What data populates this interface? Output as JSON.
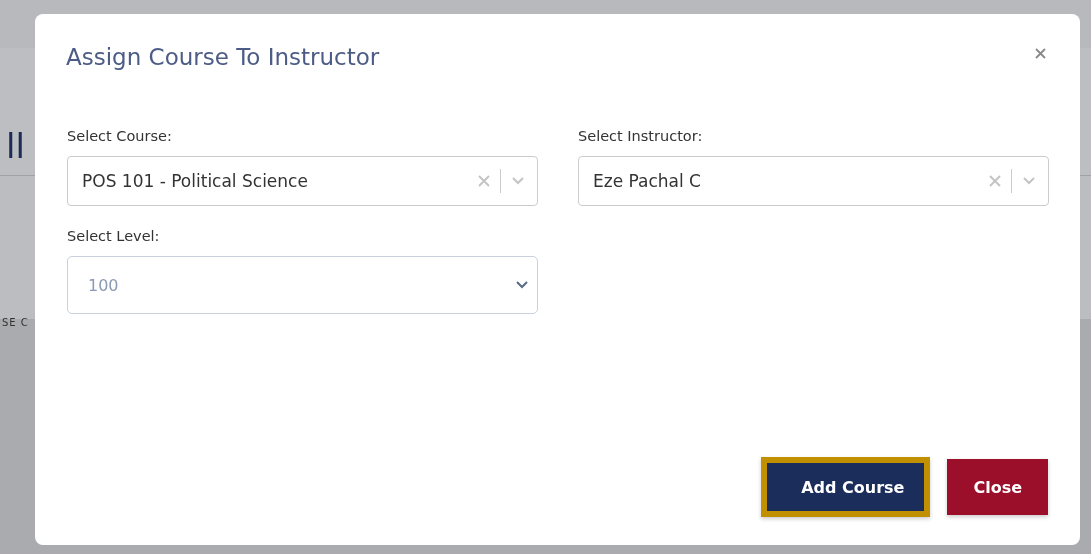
{
  "background_page": {
    "heading_fragment": "ll",
    "column_fragment": "SE C"
  },
  "dialog": {
    "title": "Assign Course To Instructor",
    "fields": [
      {
        "kind": "combo",
        "label": "Select Course:",
        "value": "POS 101 - Political Science"
      },
      {
        "kind": "combo",
        "label": "Select Instructor:",
        "value": "Eze Pachal C"
      },
      {
        "kind": "select",
        "label": "Select Level:",
        "value": "100"
      }
    ],
    "buttons": [
      {
        "label": "Add Course",
        "kind": "primary",
        "focused": true
      },
      {
        "label": "Close",
        "kind": "danger",
        "focused": false
      }
    ]
  }
}
